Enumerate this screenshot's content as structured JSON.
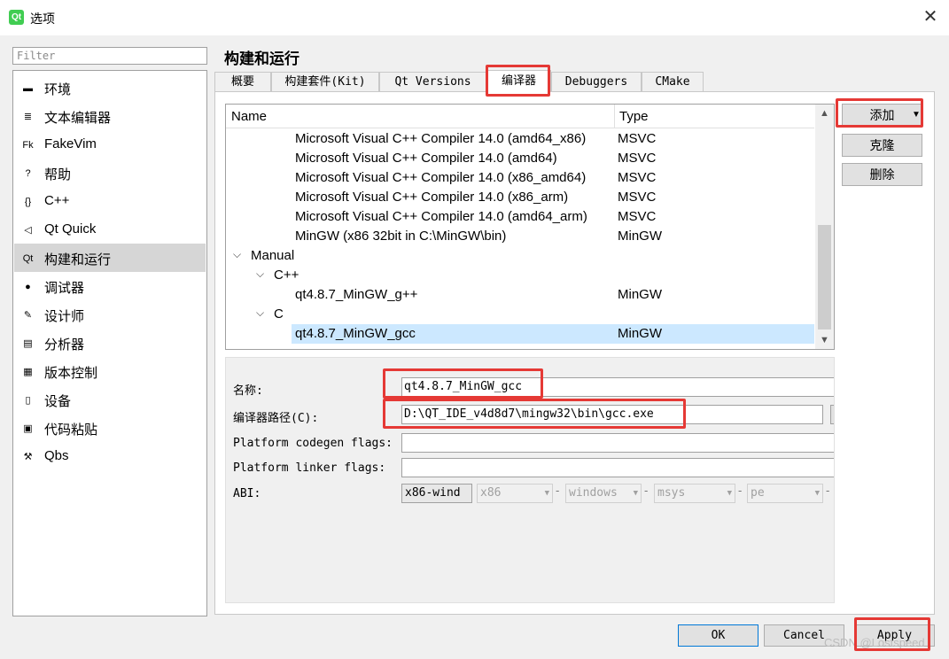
{
  "window": {
    "title": "选项",
    "app_icon": "Qt",
    "close": "✕"
  },
  "filter": {
    "placeholder": "Filter"
  },
  "categories": [
    {
      "label": "环境",
      "icon": "monitor-icon"
    },
    {
      "label": "文本编辑器",
      "icon": "text-editor-icon"
    },
    {
      "label": "FakeVim",
      "icon": "fakevim-icon"
    },
    {
      "label": "帮助",
      "icon": "help-icon"
    },
    {
      "label": "C++",
      "icon": "braces-icon"
    },
    {
      "label": "Qt Quick",
      "icon": "qtquick-icon"
    },
    {
      "label": "构建和运行",
      "icon": "build-run-icon",
      "selected": true
    },
    {
      "label": "调试器",
      "icon": "debugger-icon"
    },
    {
      "label": "设计师",
      "icon": "designer-icon"
    },
    {
      "label": "分析器",
      "icon": "analyzer-icon"
    },
    {
      "label": "版本控制",
      "icon": "version-control-icon"
    },
    {
      "label": "设备",
      "icon": "device-icon"
    },
    {
      "label": "代码粘贴",
      "icon": "code-paste-icon"
    },
    {
      "label": "Qbs",
      "icon": "hammer-icon"
    }
  ],
  "page_title": "构建和运行",
  "tabs": [
    {
      "label": "概要"
    },
    {
      "label": "构建套件(Kit)"
    },
    {
      "label": "Qt Versions"
    },
    {
      "label": "编译器",
      "active": true
    },
    {
      "label": "Debuggers"
    },
    {
      "label": "CMake"
    }
  ],
  "tree": {
    "columns": [
      "Name",
      "Type"
    ],
    "rows": [
      {
        "name": "Microsoft Visual C++ Compiler 14.0 (amd64_x86)",
        "type": "MSVC",
        "level": 3
      },
      {
        "name": "Microsoft Visual C++ Compiler 14.0 (amd64)",
        "type": "MSVC",
        "level": 3
      },
      {
        "name": "Microsoft Visual C++ Compiler 14.0 (x86_amd64)",
        "type": "MSVC",
        "level": 3
      },
      {
        "name": "Microsoft Visual C++ Compiler 14.0 (x86_arm)",
        "type": "MSVC",
        "level": 3
      },
      {
        "name": "Microsoft Visual C++ Compiler 14.0 (amd64_arm)",
        "type": "MSVC",
        "level": 3
      },
      {
        "name": "MinGW (x86 32bit in C:\\MinGW\\bin)",
        "type": "MinGW",
        "level": 3
      },
      {
        "name": "Manual",
        "type": "",
        "level": 1,
        "expanded": true
      },
      {
        "name": "C++",
        "type": "",
        "level": 2,
        "expanded": true
      },
      {
        "name": "qt4.8.7_MinGW_g++",
        "type": "MinGW",
        "level": 3
      },
      {
        "name": "C",
        "type": "",
        "level": 2,
        "expanded": true
      },
      {
        "name": "qt4.8.7_MinGW_gcc",
        "type": "MinGW",
        "level": 3,
        "selected": true
      }
    ],
    "toggle_glyph": "⌵",
    "scroll_up": "▲",
    "scroll_down": "▼"
  },
  "side_buttons": {
    "add": "添加",
    "add_arrow": "▼",
    "clone": "克隆",
    "remove": "删除"
  },
  "details": {
    "name_label": "名称:",
    "name_value": "qt4.8.7_MinGW_gcc",
    "path_label": "编译器路径(C):",
    "path_value": "D:\\QT_IDE_v4d8d7\\mingw32\\bin\\gcc.exe",
    "codegen_label": "Platform codegen flags:",
    "codegen_value": "",
    "linker_label": "Platform linker flags:",
    "linker_value": "",
    "abi_label": "ABI:",
    "abi_values": [
      "x86-wind",
      "x86",
      "windows",
      "msys",
      "pe"
    ],
    "abi_separator": "-"
  },
  "footer": {
    "ok": "OK",
    "cancel": "Cancel",
    "apply": "Apply",
    "watermark": "CSDN @Lostspeed"
  },
  "colors": {
    "highlight": "#e53935",
    "selection": "#cce8ff",
    "accent": "#0078d7"
  }
}
